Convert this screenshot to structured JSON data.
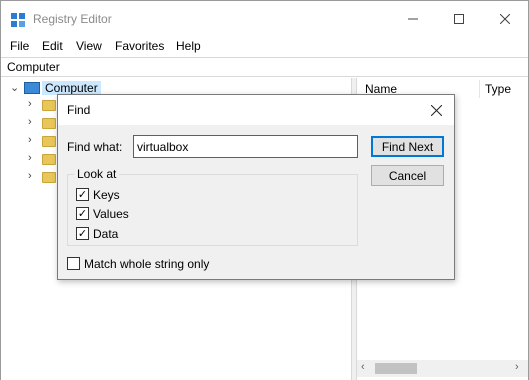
{
  "window": {
    "title": "Registry Editor"
  },
  "menu": [
    "File",
    "Edit",
    "View",
    "Favorites",
    "Help"
  ],
  "address": "Computer",
  "tree": {
    "root_label": "Computer"
  },
  "list": {
    "columns": [
      "Name",
      "Type"
    ]
  },
  "find_dialog": {
    "title": "Find",
    "find_what_label": "Find what:",
    "find_value": "virtualbox",
    "find_next_label": "Find Next",
    "cancel_label": "Cancel",
    "look_at_label": "Look at",
    "options": [
      {
        "label": "Keys",
        "checked": true
      },
      {
        "label": "Values",
        "checked": true
      },
      {
        "label": "Data",
        "checked": true
      }
    ],
    "match_whole_label": "Match whole string only",
    "match_whole_checked": false
  },
  "colors": {
    "accent": "#0078d7",
    "selection": "#cce8ff",
    "folder": "#e9c659"
  }
}
